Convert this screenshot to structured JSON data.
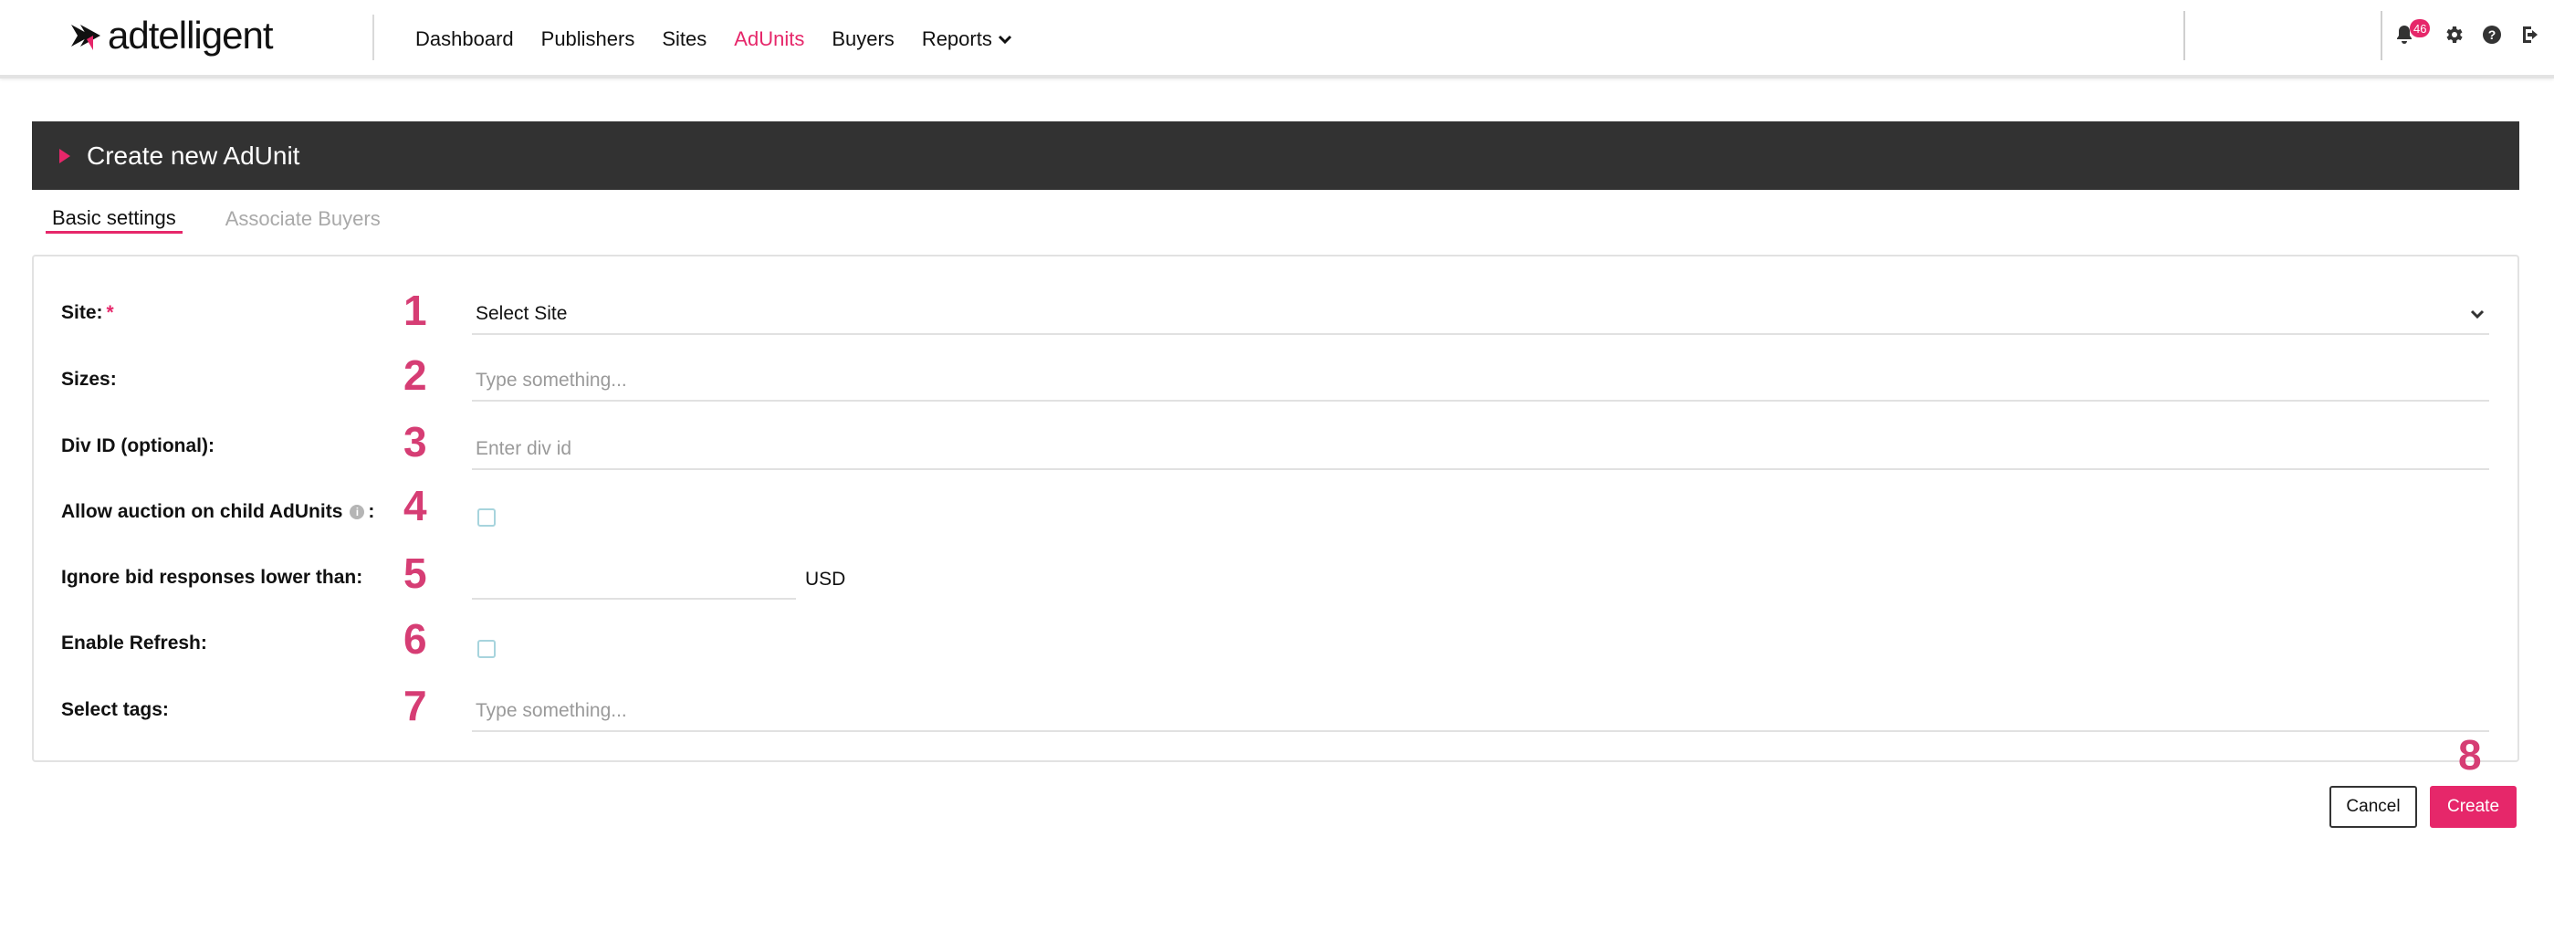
{
  "nav": {
    "logo_text": "adtelligent",
    "links": [
      {
        "label": "Dashboard"
      },
      {
        "label": "Publishers"
      },
      {
        "label": "Sites"
      },
      {
        "label": "AdUnits",
        "active": true
      },
      {
        "label": "Buyers"
      },
      {
        "label": "Reports"
      }
    ],
    "notification_count": "46",
    "icons": [
      "bell-icon",
      "gear-icon",
      "help-icon",
      "logout-icon"
    ]
  },
  "header": {
    "title": "Create new AdUnit"
  },
  "tabs": {
    "basic": "Basic settings",
    "buyers": "Associate Buyers"
  },
  "form": {
    "site": {
      "label": "Site:",
      "required_mark": "*",
      "number": "1",
      "value": "Select Site"
    },
    "sizes": {
      "label": "Sizes:",
      "number": "2",
      "placeholder": "Type something..."
    },
    "div_id": {
      "label": "Div ID (optional):",
      "number": "3",
      "placeholder": "Enter div id"
    },
    "allow_auction": {
      "label_prefix": "Allow auction on child AdUnits",
      "label_suffix": ":",
      "number": "4",
      "checked": false
    },
    "ignore_bid": {
      "label": "Ignore bid responses lower than:",
      "number": "5",
      "value": "",
      "unit": "USD"
    },
    "enable_refresh": {
      "label": "Enable Refresh:",
      "number": "6",
      "checked": false
    },
    "tags": {
      "label": "Select tags:",
      "number": "7",
      "placeholder": "Type something..."
    }
  },
  "actions": {
    "number": "8",
    "cancel": "Cancel",
    "create": "Create"
  },
  "colors": {
    "accent": "#e6276a",
    "header_bg": "#323232",
    "annotation": "#d63d74"
  }
}
